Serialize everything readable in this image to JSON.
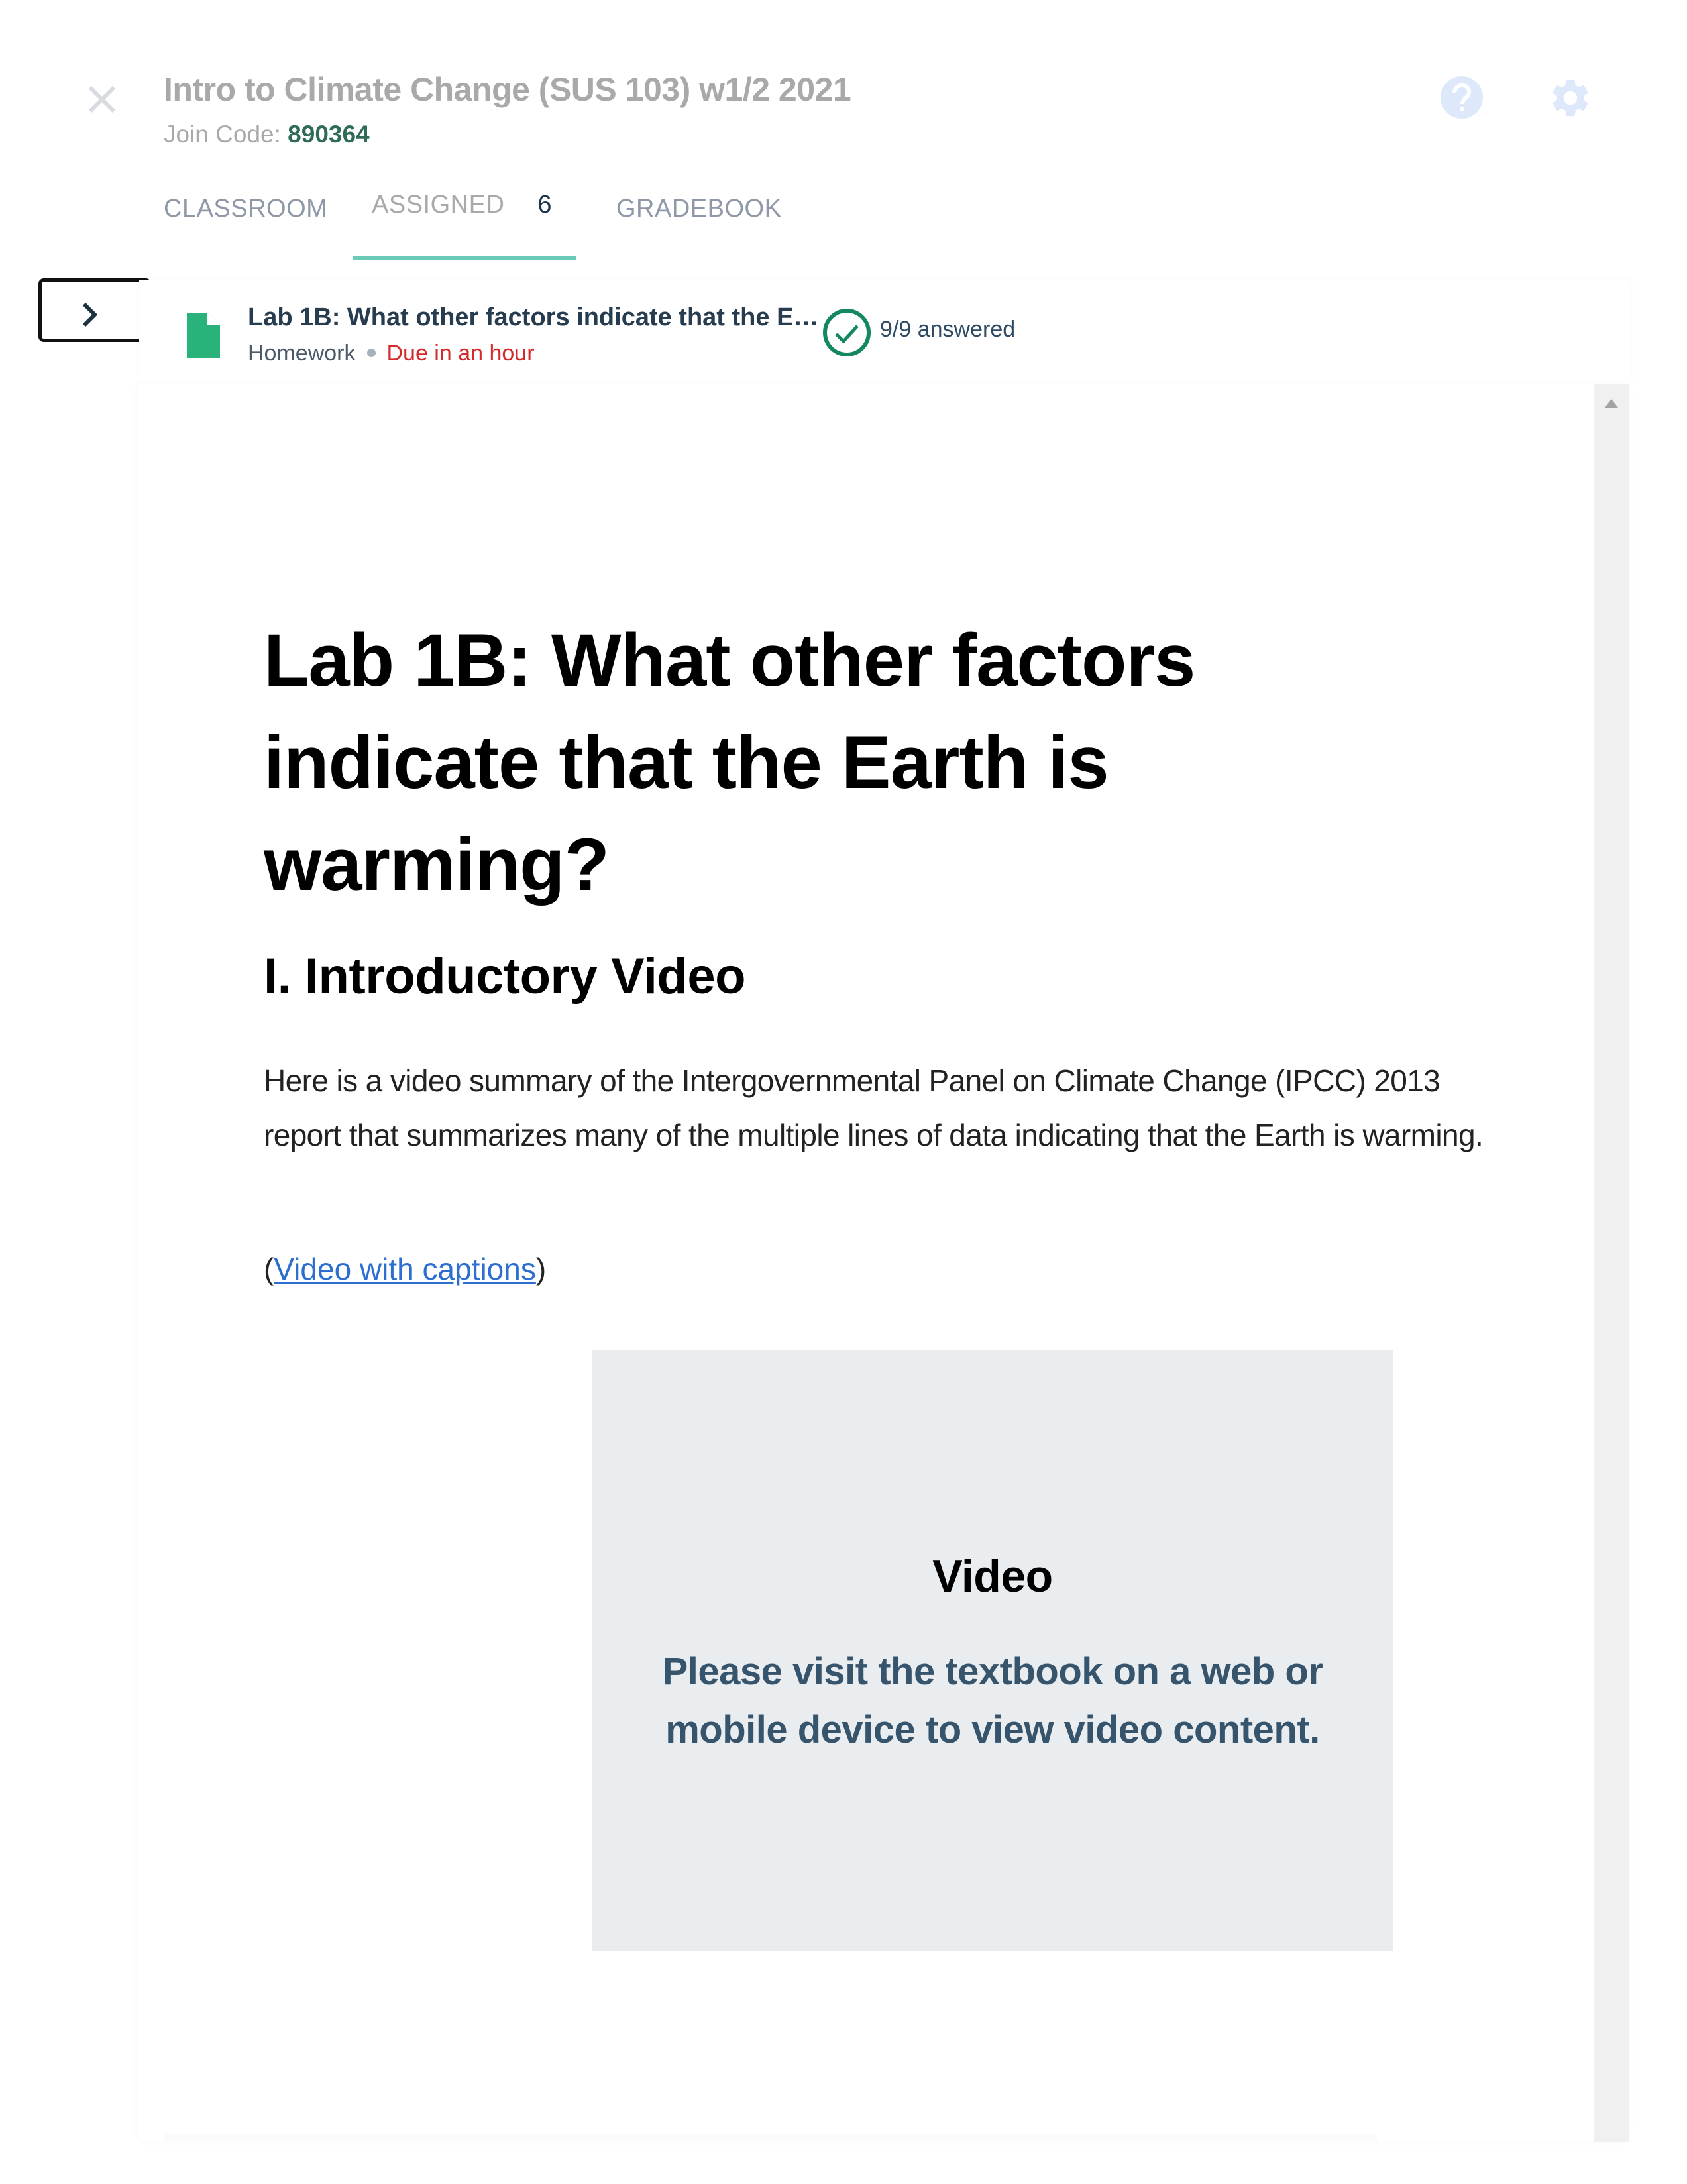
{
  "header": {
    "course_title": "Intro to Climate Change (SUS 103) w1/2 2021",
    "join_code_label": "Join Code:",
    "join_code": "890364",
    "icons": {
      "close": "close-icon",
      "help": "help-circle-icon",
      "settings": "gear-icon"
    }
  },
  "tabs": [
    {
      "label": "CLASSROOM",
      "active": false
    },
    {
      "label": "ASSIGNED",
      "count": "6",
      "active": true
    },
    {
      "label": "GRADEBOOK",
      "active": false
    }
  ],
  "assignment": {
    "title": "Lab 1B: What other factors indicate that the E…",
    "type": "Homework",
    "due": "Due in an hour",
    "progress_text": "9/9 answered",
    "answered": 9,
    "total": 9,
    "icon": "document-icon"
  },
  "document": {
    "title": "Lab 1B: What other factors indicate that the Earth is warming?",
    "section_heading": "I. Introductory Video",
    "intro_paragraph": "Here is a video summary of the  Intergovernmental Panel on Climate Change (IPCC) 2013 report that summarizes many of the multiple lines of data indicating that the Earth is warming.",
    "captions_open": "(",
    "captions_link": "Video with captions",
    "captions_close": ")",
    "video": {
      "label": "Video",
      "message": "Please visit the textbook on a web or mobile device to view video content."
    }
  },
  "colors": {
    "accent_tab": "#6ccbb8",
    "join_code": "#2f6b56",
    "due_red": "#d42a2a",
    "check_green": "#13875f",
    "file_green": "#2ab27b",
    "icon_light_blue": "#dde9fb",
    "link_blue": "#2d6fd1",
    "video_bg": "#eaedf0",
    "video_text": "#37546d"
  }
}
